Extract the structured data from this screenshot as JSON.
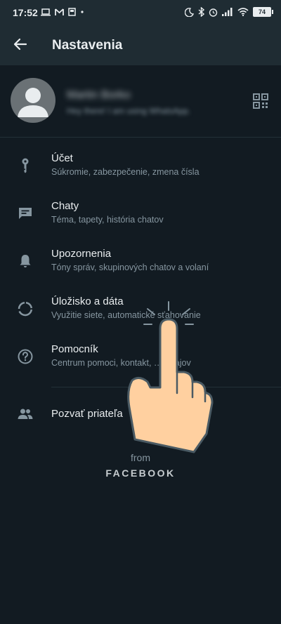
{
  "status_bar": {
    "time": "17:52",
    "battery": "74"
  },
  "app_bar": {
    "title": "Nastavenia"
  },
  "profile": {
    "name": "Martin Borko",
    "status": "Hey there! I am using WhatsApp."
  },
  "settings": [
    {
      "label": "Účet",
      "sub": "Súkromie, zabezpečenie, zmena čísla",
      "icon": "key-icon"
    },
    {
      "label": "Chaty",
      "sub": "Téma, tapety, história chatov",
      "icon": "chat-icon"
    },
    {
      "label": "Upozornenia",
      "sub": "Tóny správ, skupinových chatov a volaní",
      "icon": "bell-icon"
    },
    {
      "label": "Úložisko a dáta",
      "sub": "Využitie siete, automatické sťahovanie",
      "icon": "storage-icon"
    },
    {
      "label": "Pomocník",
      "sub": "Centrum pomoci, kontakt, … údajov",
      "icon": "help-icon"
    }
  ],
  "invite": {
    "label": "Pozvať priateľa",
    "icon": "people-icon"
  },
  "footer": {
    "from": "from",
    "brand": "FACEBOOK"
  },
  "colors": {
    "background": "#121b22",
    "app_bar": "#1f2c33",
    "icon": "#8696a0",
    "primary_text": "#e9edef",
    "secondary_text": "#8696a0"
  }
}
